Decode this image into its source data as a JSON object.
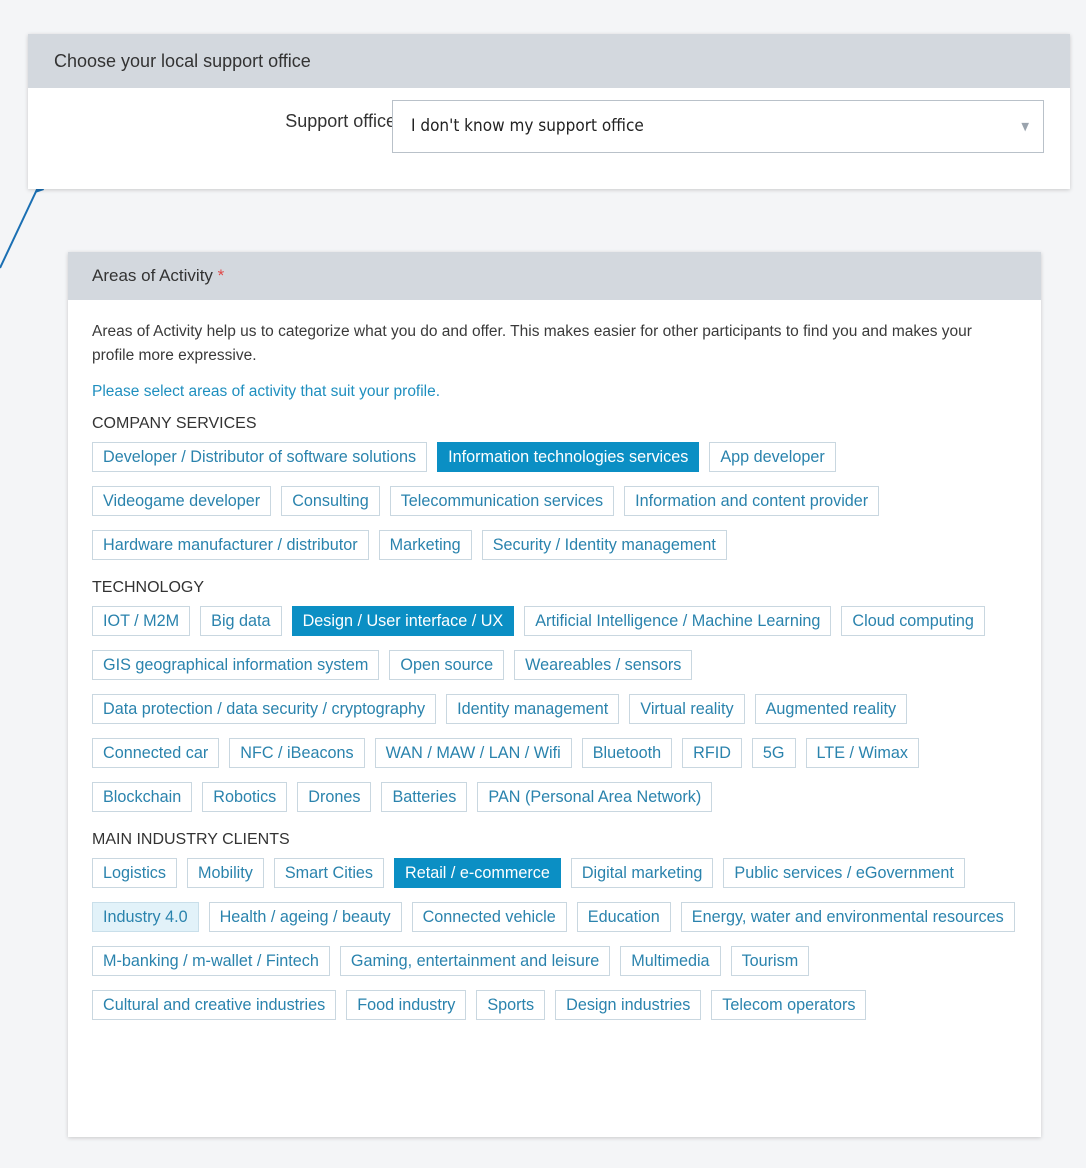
{
  "support_office": {
    "section_title": "Choose your local support office",
    "label": "Support office",
    "selected_value": "I don't know my support office"
  },
  "activity": {
    "section_title": "Areas of Activity",
    "required_mark": "*",
    "description": "Areas of Activity help us to categorize what you do and offer. This makes easier for other participants to find you and makes your profile more expressive.",
    "hint": "Please select areas of activity that suit your profile.",
    "groups": [
      {
        "title": "COMPANY SERVICES",
        "tags": [
          {
            "label": "Developer / Distributor of software solutions",
            "state": "default"
          },
          {
            "label": "Information technologies services",
            "state": "selected"
          },
          {
            "label": "App developer",
            "state": "default"
          },
          {
            "label": "Videogame developer",
            "state": "default"
          },
          {
            "label": "Consulting",
            "state": "default"
          },
          {
            "label": "Telecommunication services",
            "state": "default"
          },
          {
            "label": "Information and content provider",
            "state": "default"
          },
          {
            "label": "Hardware manufacturer / distributor",
            "state": "default"
          },
          {
            "label": "Marketing",
            "state": "default"
          },
          {
            "label": "Security / Identity management",
            "state": "default"
          }
        ]
      },
      {
        "title": "TECHNOLOGY",
        "tags": [
          {
            "label": "IOT / M2M",
            "state": "default"
          },
          {
            "label": "Big data",
            "state": "default"
          },
          {
            "label": "Design / User interface / UX",
            "state": "selected"
          },
          {
            "label": "Artificial Intelligence / Machine Learning",
            "state": "default"
          },
          {
            "label": "Cloud computing",
            "state": "default"
          },
          {
            "label": "GIS geographical information system",
            "state": "default"
          },
          {
            "label": "Open source",
            "state": "default"
          },
          {
            "label": "Weareables / sensors",
            "state": "default"
          },
          {
            "label": "Data protection / data security / cryptography",
            "state": "default"
          },
          {
            "label": "Identity management",
            "state": "default"
          },
          {
            "label": "Virtual reality",
            "state": "default"
          },
          {
            "label": "Augmented reality",
            "state": "default"
          },
          {
            "label": "Connected car",
            "state": "default"
          },
          {
            "label": "NFC / iBeacons",
            "state": "default"
          },
          {
            "label": "WAN / MAW / LAN / Wifi",
            "state": "default"
          },
          {
            "label": "Bluetooth",
            "state": "default"
          },
          {
            "label": "RFID",
            "state": "default"
          },
          {
            "label": "5G",
            "state": "default"
          },
          {
            "label": "LTE / Wimax",
            "state": "default"
          },
          {
            "label": "Blockchain",
            "state": "default"
          },
          {
            "label": "Robotics",
            "state": "default"
          },
          {
            "label": "Drones",
            "state": "default"
          },
          {
            "label": "Batteries",
            "state": "default"
          },
          {
            "label": "PAN (Personal Area Network)",
            "state": "default"
          }
        ]
      },
      {
        "title": "MAIN INDUSTRY CLIENTS",
        "tags": [
          {
            "label": "Logistics",
            "state": "default"
          },
          {
            "label": "Mobility",
            "state": "default"
          },
          {
            "label": "Smart Cities",
            "state": "default"
          },
          {
            "label": "Retail / e-commerce",
            "state": "selected"
          },
          {
            "label": "Digital marketing",
            "state": "default"
          },
          {
            "label": "Public services / eGovernment",
            "state": "default"
          },
          {
            "label": "Industry 4.0",
            "state": "hover"
          },
          {
            "label": "Health / ageing / beauty",
            "state": "default"
          },
          {
            "label": "Connected vehicle",
            "state": "default"
          },
          {
            "label": "Education",
            "state": "default"
          },
          {
            "label": "Energy, water and environmental resources",
            "state": "default"
          },
          {
            "label": "M-banking / m-wallet / Fintech",
            "state": "default"
          },
          {
            "label": "Gaming, entertainment and leisure",
            "state": "default"
          },
          {
            "label": "Multimedia",
            "state": "default"
          },
          {
            "label": "Tourism",
            "state": "default"
          },
          {
            "label": "Cultural and creative industries",
            "state": "default"
          },
          {
            "label": "Food industry",
            "state": "default"
          },
          {
            "label": "Sports",
            "state": "default"
          },
          {
            "label": "Design industries",
            "state": "default"
          },
          {
            "label": "Telecom operators",
            "state": "default"
          }
        ]
      }
    ]
  },
  "colors": {
    "header_bg": "#d3d8de",
    "tag_text": "#2a83ad",
    "tag_selected_bg": "#0b8fc4",
    "hint_text": "#1f8fbf",
    "required": "#e04848",
    "annotation_arrow": "#1a6fb3"
  },
  "icons": {
    "select_arrow": "chevron-down-icon"
  }
}
